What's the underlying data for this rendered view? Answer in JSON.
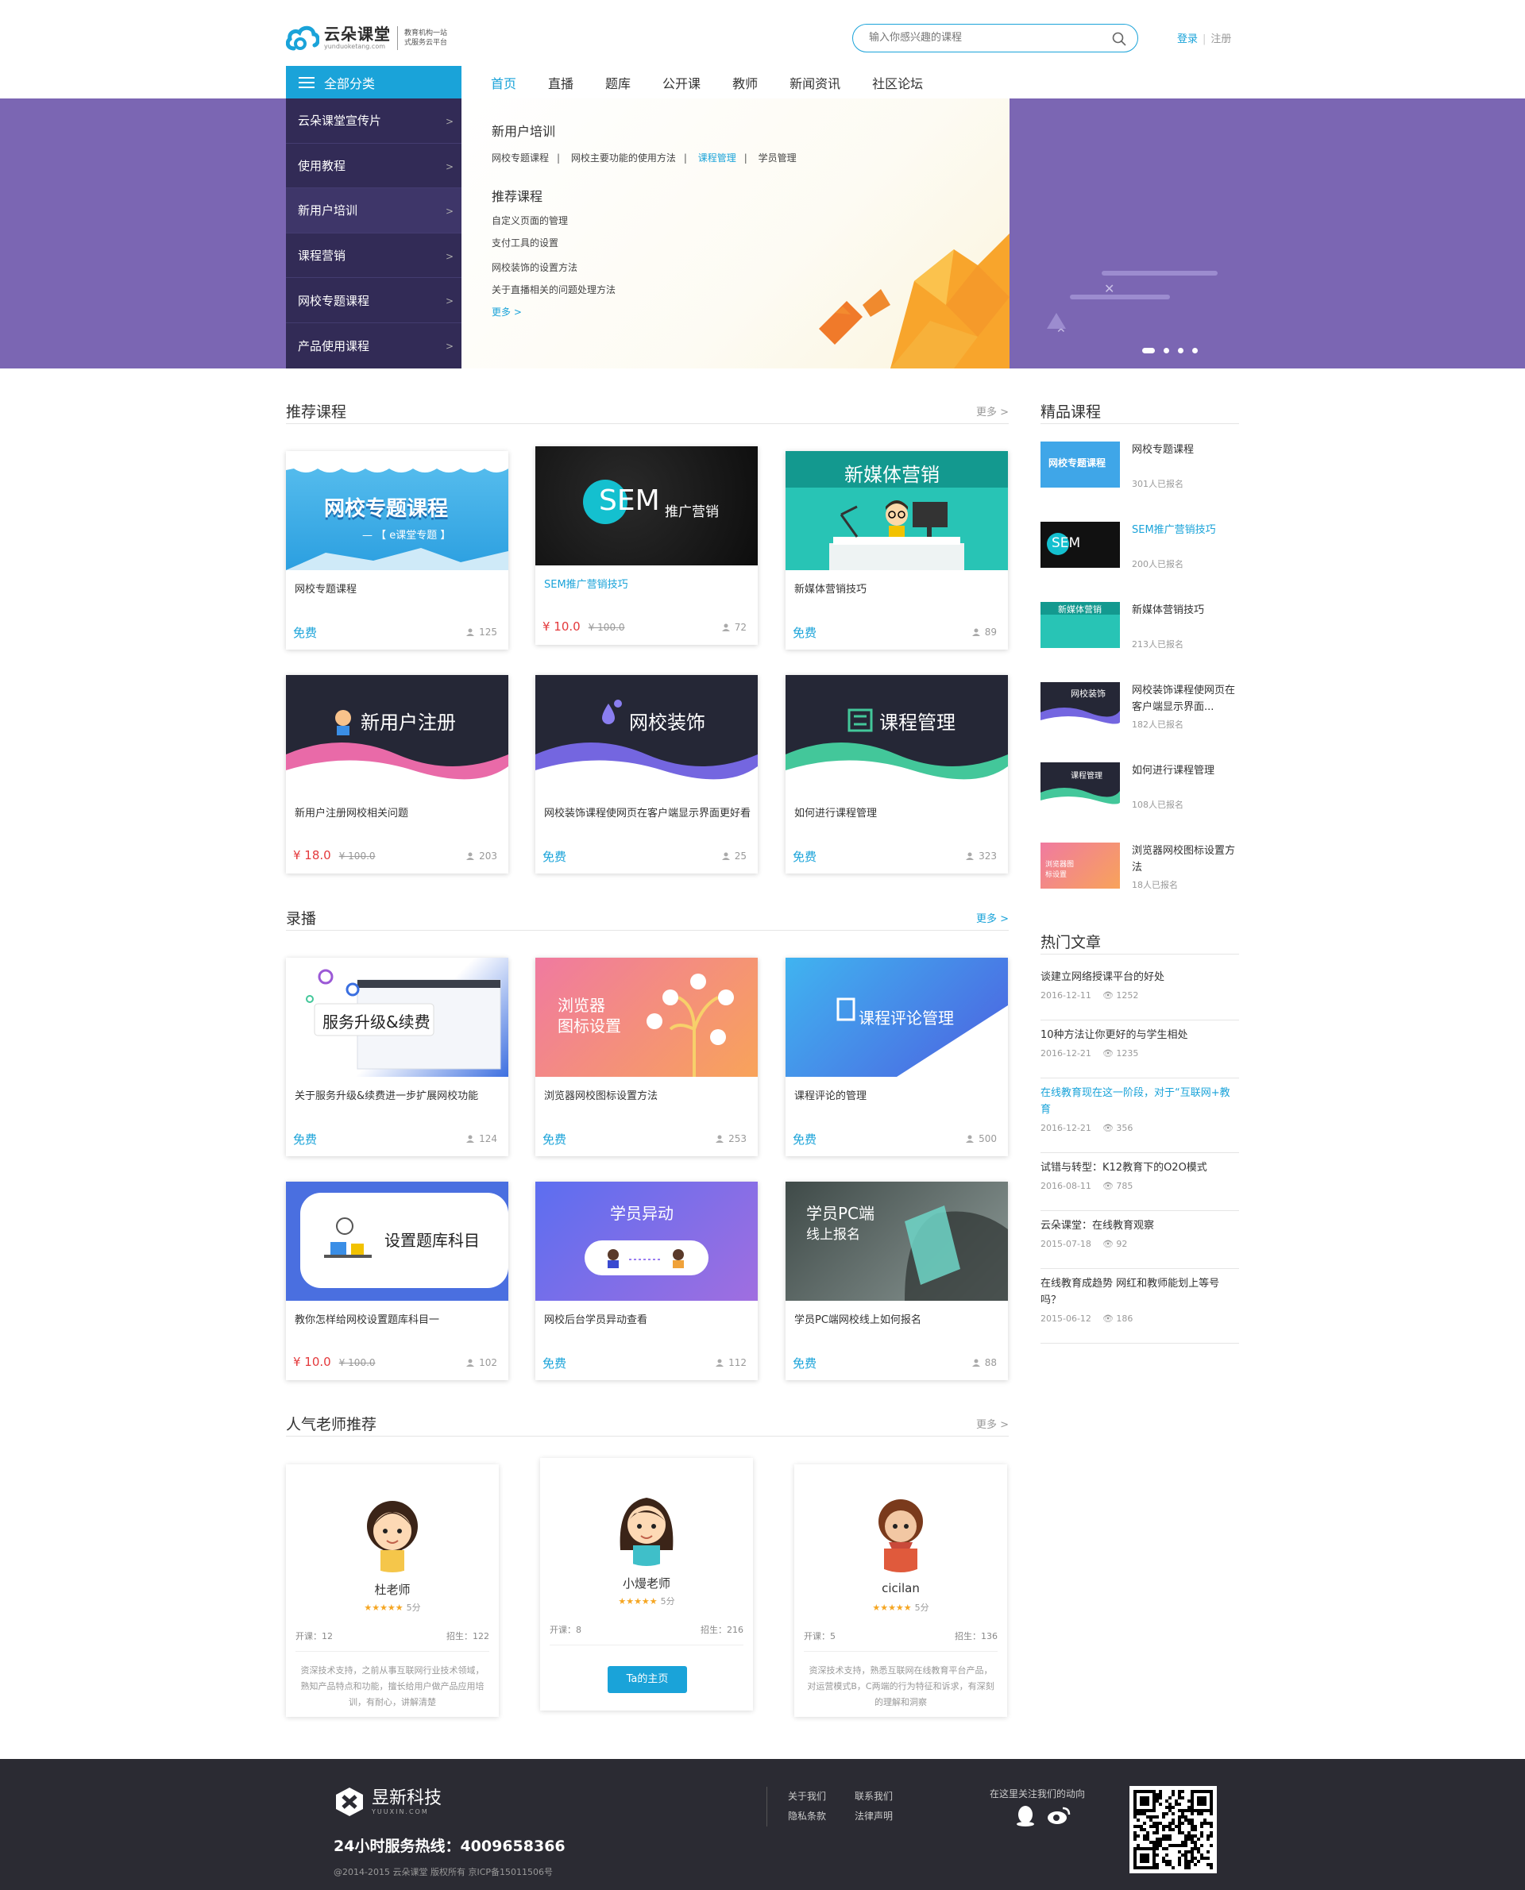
{
  "header": {
    "logo_name": "云朵课堂",
    "logo_url_text": "yunduoketang.com",
    "slogan_line1": "教育机构一站",
    "slogan_line2": "式服务云平台",
    "search_placeholder": "输入你感兴趣的课程",
    "login": "登录",
    "register": "注册",
    "separator": "|"
  },
  "nav": {
    "all_categories": "全部分类",
    "items": [
      "首页",
      "直播",
      "题库",
      "公开课",
      "教师",
      "新闻资讯",
      "社区论坛"
    ]
  },
  "sidebar": {
    "items": [
      "云朵课堂宣传片",
      "使用教程",
      "新用户培训",
      "课程营销",
      "网校专题课程",
      "产品使用课程"
    ]
  },
  "dropdown": {
    "title1": "新用户培训",
    "links": [
      "网校专题课程",
      "网校主要功能的使用方法",
      "课程管理",
      "学员管理"
    ],
    "title2": "推荐课程",
    "recs": [
      "自定义页面的管理",
      "支付工具的设置",
      "网校装饰的设置方法",
      "关于直播相关的问题处理方法"
    ],
    "more": "更多 >"
  },
  "sections": {
    "recommended": {
      "title": "推荐课程",
      "more": "更多 >"
    },
    "recorded": {
      "title": "录播",
      "more": "更多 >"
    },
    "teachers": {
      "title": "人气老师推荐",
      "more": "更多 >"
    },
    "premium": {
      "title": "精品课程"
    },
    "articles": {
      "title": "热门文章"
    }
  },
  "recommended_courses": [
    {
      "img_text": "网校专题课程",
      "img_sub": "— 【 e课堂专题 】",
      "title": "网校专题课程",
      "price": "免费",
      "count": "125"
    },
    {
      "img_text": "SEM",
      "img_sub": "推广营销",
      "title": "SEM推广营销技巧",
      "price": "¥ 10.0",
      "old": "¥ 100.0",
      "count": "72"
    },
    {
      "img_text": "新媒体营销",
      "title": "新媒体营销技巧",
      "price": "免费",
      "count": "89"
    },
    {
      "img_text": "新用户注册",
      "title": "新用户注册网校相关问题",
      "price": "¥ 18.0",
      "old": "¥ 100.0",
      "count": "203"
    },
    {
      "img_text": "网校装饰",
      "title": "网校装饰课程使网页在客户端显示界面更好看",
      "price": "免费",
      "count": "25"
    },
    {
      "img_text": "课程管理",
      "title": "如何进行课程管理",
      "price": "免费",
      "count": "323"
    }
  ],
  "recorded_courses": [
    {
      "img_text": "服务升级&续费",
      "title": "关于服务升级&续费进一步扩展网校功能",
      "price": "免费",
      "count": "124"
    },
    {
      "img_text": "浏览器",
      "img_sub": "图标设置",
      "title": "浏览器网校图标设置方法",
      "price": "免费",
      "count": "253"
    },
    {
      "img_text": "课程评论管理",
      "title": "课程评论的管理",
      "price": "免费",
      "count": "500"
    },
    {
      "img_text": "设置题库科目",
      "title": "教你怎样给网校设置题库科目一",
      "price": "¥ 10.0",
      "old": "¥ 100.0",
      "count": "102"
    },
    {
      "img_text": "学员异动",
      "title": "网校后台学员异动查看",
      "price": "免费",
      "count": "112"
    },
    {
      "img_text": "学员PC端",
      "img_sub": "线上报名",
      "title": "学员PC端网校线上如何报名",
      "price": "免费",
      "count": "88"
    }
  ],
  "premium_courses": [
    {
      "thumb_text": "网校专题课程",
      "title": "网校专题课程",
      "enrolled": "301人已报名"
    },
    {
      "thumb_text": "SEM",
      "title": "SEM推广营销技巧",
      "enrolled": "200人已报名"
    },
    {
      "thumb_text": "新媒体营销",
      "title": "新媒体营销技巧",
      "enrolled": "213人已报名"
    },
    {
      "thumb_text": "网校装饰",
      "title": "网校装饰课程使网页在客户端显示界面...",
      "enrolled": "182人已报名"
    },
    {
      "thumb_text": "课程管理",
      "title": "如何进行课程管理",
      "enrolled": "108人已报名"
    },
    {
      "thumb_text": "浏览器图标设置",
      "title": "浏览器网校图标设置方法",
      "enrolled": "18人已报名"
    }
  ],
  "articles": [
    {
      "title": "谈建立网络授课平台的好处",
      "date": "2016-12-11",
      "views": "1252"
    },
    {
      "title": "10种方法让你更好的与学生相处",
      "date": "2016-12-21",
      "views": "1235"
    },
    {
      "title": "在线教育现在这一阶段，对于“互联网+教育",
      "date": "2016-12-21",
      "views": "356"
    },
    {
      "title": "试错与转型：K12教育下的O2O模式",
      "date": "2016-08-11",
      "views": "785"
    },
    {
      "title": "云朵课堂：在线教育观察",
      "date": "2015-07-18",
      "views": "92"
    },
    {
      "title": "在线教育成趋势 网红和教师能划上等号吗？",
      "date": "2015-06-12",
      "views": "186"
    }
  ],
  "teachers": [
    {
      "name": "杜老师",
      "stars": "★★★★★",
      "score": "5分",
      "open": "开课：12",
      "students": "招生：122",
      "desc": "资深技术支持，之前从事互联网行业技术领域，熟知产品特点和功能，擅长给用户做产品应用培训，有耐心，讲解清楚"
    },
    {
      "name": "小熳老师",
      "stars": "★★★★★",
      "score": "5分",
      "open": "开课：8",
      "students": "招生：216",
      "button": "Ta的主页"
    },
    {
      "name": "cicilan",
      "stars": "★★★★★",
      "score": "5分",
      "open": "开课：5",
      "students": "招生：136",
      "desc": "资深技术支持，熟悉互联网在线教育平台产品，对运营模式B，C两端的行为特征和诉求，有深刻的理解和洞察"
    }
  ],
  "footer": {
    "logo_name": "昱新科技",
    "logo_sub": "YUUXIN.COM",
    "hotline": "24小时服务热线：4009658366",
    "copyright": "@2014-2015 云朵课堂  版权所有  京ICP备15011506号",
    "links": [
      "关于我们",
      "联系我们",
      "隐私条款",
      "法律声明"
    ],
    "follow": "在这里关注我们的动向"
  },
  "colors": {
    "accent": "#1aa3d9",
    "banner": "#7b66b3",
    "sidebar": "#322b56",
    "price": "#e4393c",
    "footer": "#2b2b33"
  }
}
